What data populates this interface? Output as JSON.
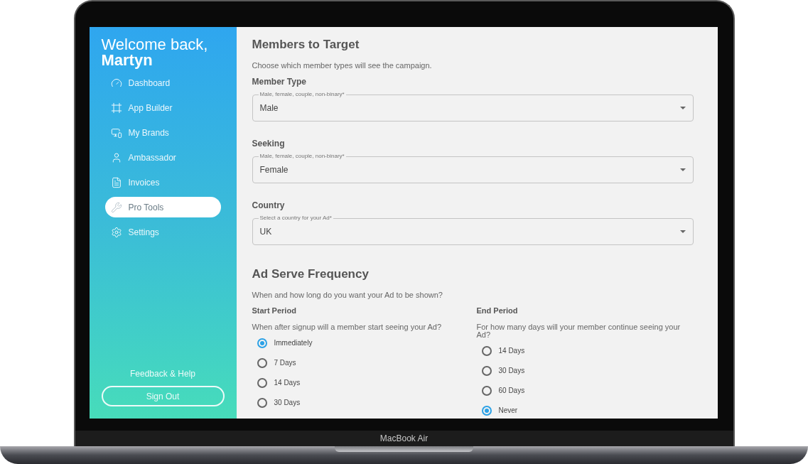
{
  "sidebar": {
    "greeting": "Welcome back,",
    "name": "Martyn",
    "items": [
      {
        "label": "Dashboard",
        "selected": false
      },
      {
        "label": "App Builder",
        "selected": false
      },
      {
        "label": "My Brands",
        "selected": false
      },
      {
        "label": "Ambassador",
        "selected": false
      },
      {
        "label": "Invoices",
        "selected": false
      },
      {
        "label": "Pro Tools",
        "selected": true
      },
      {
        "label": "Settings",
        "selected": false
      }
    ],
    "feedback_link": "Feedback & Help",
    "sign_out": "Sign Out"
  },
  "members_to_target": {
    "title": "Members to Target",
    "subtitle": "Choose which member types will see the campaign.",
    "fields": [
      {
        "label": "Member Type",
        "floating_label": "Male, female, couple, non-binary*",
        "value": "Male"
      },
      {
        "label": "Seeking",
        "floating_label": "Male, female, couple, non-binary*",
        "value": "Female"
      },
      {
        "label": "Country",
        "floating_label": "Select a country for your Ad*",
        "value": "UK"
      }
    ]
  },
  "ad_serve_frequency": {
    "title": "Ad Serve Frequency",
    "subtitle": "When and how long do you want your Ad to be shown?",
    "groups": [
      {
        "label": "Start Period",
        "description": "When after signup will a member start seeing your Ad?",
        "options": [
          {
            "label": "Immediately",
            "selected": true
          },
          {
            "label": "7 Days",
            "selected": false
          },
          {
            "label": "14 Days",
            "selected": false
          },
          {
            "label": "30 Days",
            "selected": false
          }
        ]
      },
      {
        "label": "End Period",
        "description": "For how many days will your member continue seeing your Ad?",
        "options": [
          {
            "label": "14 Days",
            "selected": false
          },
          {
            "label": "30 Days",
            "selected": false
          },
          {
            "label": "60 Days",
            "selected": false
          },
          {
            "label": "Never",
            "selected": true
          }
        ]
      }
    ]
  },
  "device_label": "MacBook Air"
}
